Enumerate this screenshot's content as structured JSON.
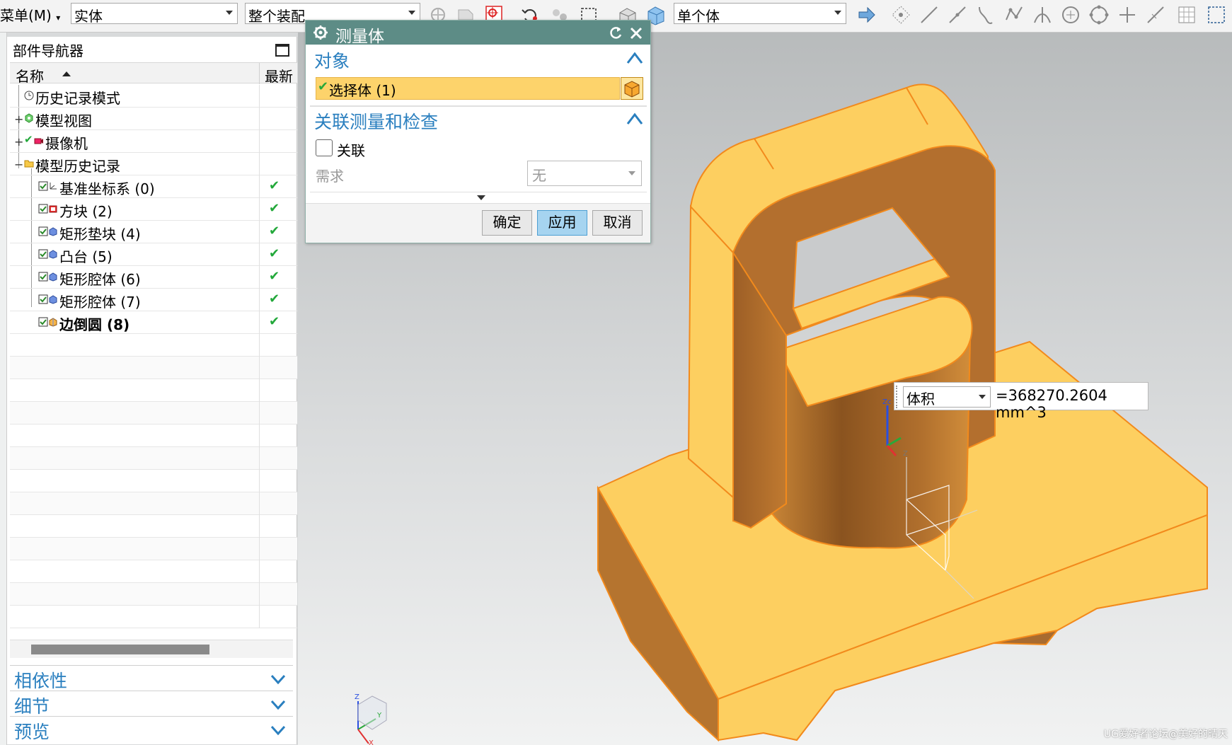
{
  "toolbar": {
    "menu_label": "菜单(M)",
    "filter_value": "实体",
    "scope_value": "整个装配",
    "body_filter_value": "单个体"
  },
  "part_navigator": {
    "title": "部件导航器",
    "columns": {
      "name": "名称",
      "latest": "最新"
    },
    "items": [
      {
        "label": "历史记录模式",
        "icon": "clock-icon",
        "level": 1,
        "expander": "",
        "check": "",
        "bold": false
      },
      {
        "label": "模型视图",
        "icon": "model-view-icon",
        "level": 1,
        "expander": "+",
        "check": "",
        "bold": false
      },
      {
        "label": "摄像机",
        "icon": "camera-icon",
        "level": 1,
        "expander": "+",
        "check": "",
        "bold": false
      },
      {
        "label": "模型历史记录",
        "icon": "folder-icon",
        "level": 1,
        "expander": "−",
        "check": "",
        "bold": false
      },
      {
        "label": "基准坐标系 (0)",
        "icon": "datum-csys-icon",
        "level": 2,
        "expander": "",
        "check": "✔",
        "bold": false
      },
      {
        "label": "方块 (2)",
        "icon": "block-icon",
        "level": 2,
        "expander": "",
        "check": "✔",
        "bold": false
      },
      {
        "label": "矩形垫块 (4)",
        "icon": "pad-icon",
        "level": 2,
        "expander": "",
        "check": "✔",
        "bold": false
      },
      {
        "label": "凸台 (5)",
        "icon": "boss-icon",
        "level": 2,
        "expander": "",
        "check": "✔",
        "bold": false
      },
      {
        "label": "矩形腔体 (6)",
        "icon": "pocket-icon",
        "level": 2,
        "expander": "",
        "check": "✔",
        "bold": false
      },
      {
        "label": "矩形腔体 (7)",
        "icon": "pocket-icon",
        "level": 2,
        "expander": "",
        "check": "✔",
        "bold": false
      },
      {
        "label": "边倒圆 (8)",
        "icon": "edge-blend-icon",
        "level": 2,
        "expander": "",
        "check": "✔",
        "bold": true
      }
    ],
    "panels": [
      "相依性",
      "细节",
      "预览"
    ]
  },
  "dialog": {
    "title": "测量体",
    "section_object": "对象",
    "select_body": "选择体 (1)",
    "section_assoc": "关联测量和检查",
    "assoc_label": "关联",
    "requirement_label": "需求",
    "requirement_value": "无",
    "buttons": {
      "ok": "确定",
      "apply": "应用",
      "cancel": "取消"
    }
  },
  "measure_tooltip": {
    "type_value": "体积",
    "result": "=368270.2604 mm^3"
  },
  "watermark": "UG爱好者论坛@美好的晴天",
  "colors": {
    "part_fill": "#fdcf60",
    "part_shadow": "#a5652c",
    "part_edge": "#f28a1c",
    "dialog_header": "#5d8c86",
    "section_title": "#2a7fbf",
    "selection_row": "#fdd36b",
    "apply_button": "#a6d4f0"
  }
}
